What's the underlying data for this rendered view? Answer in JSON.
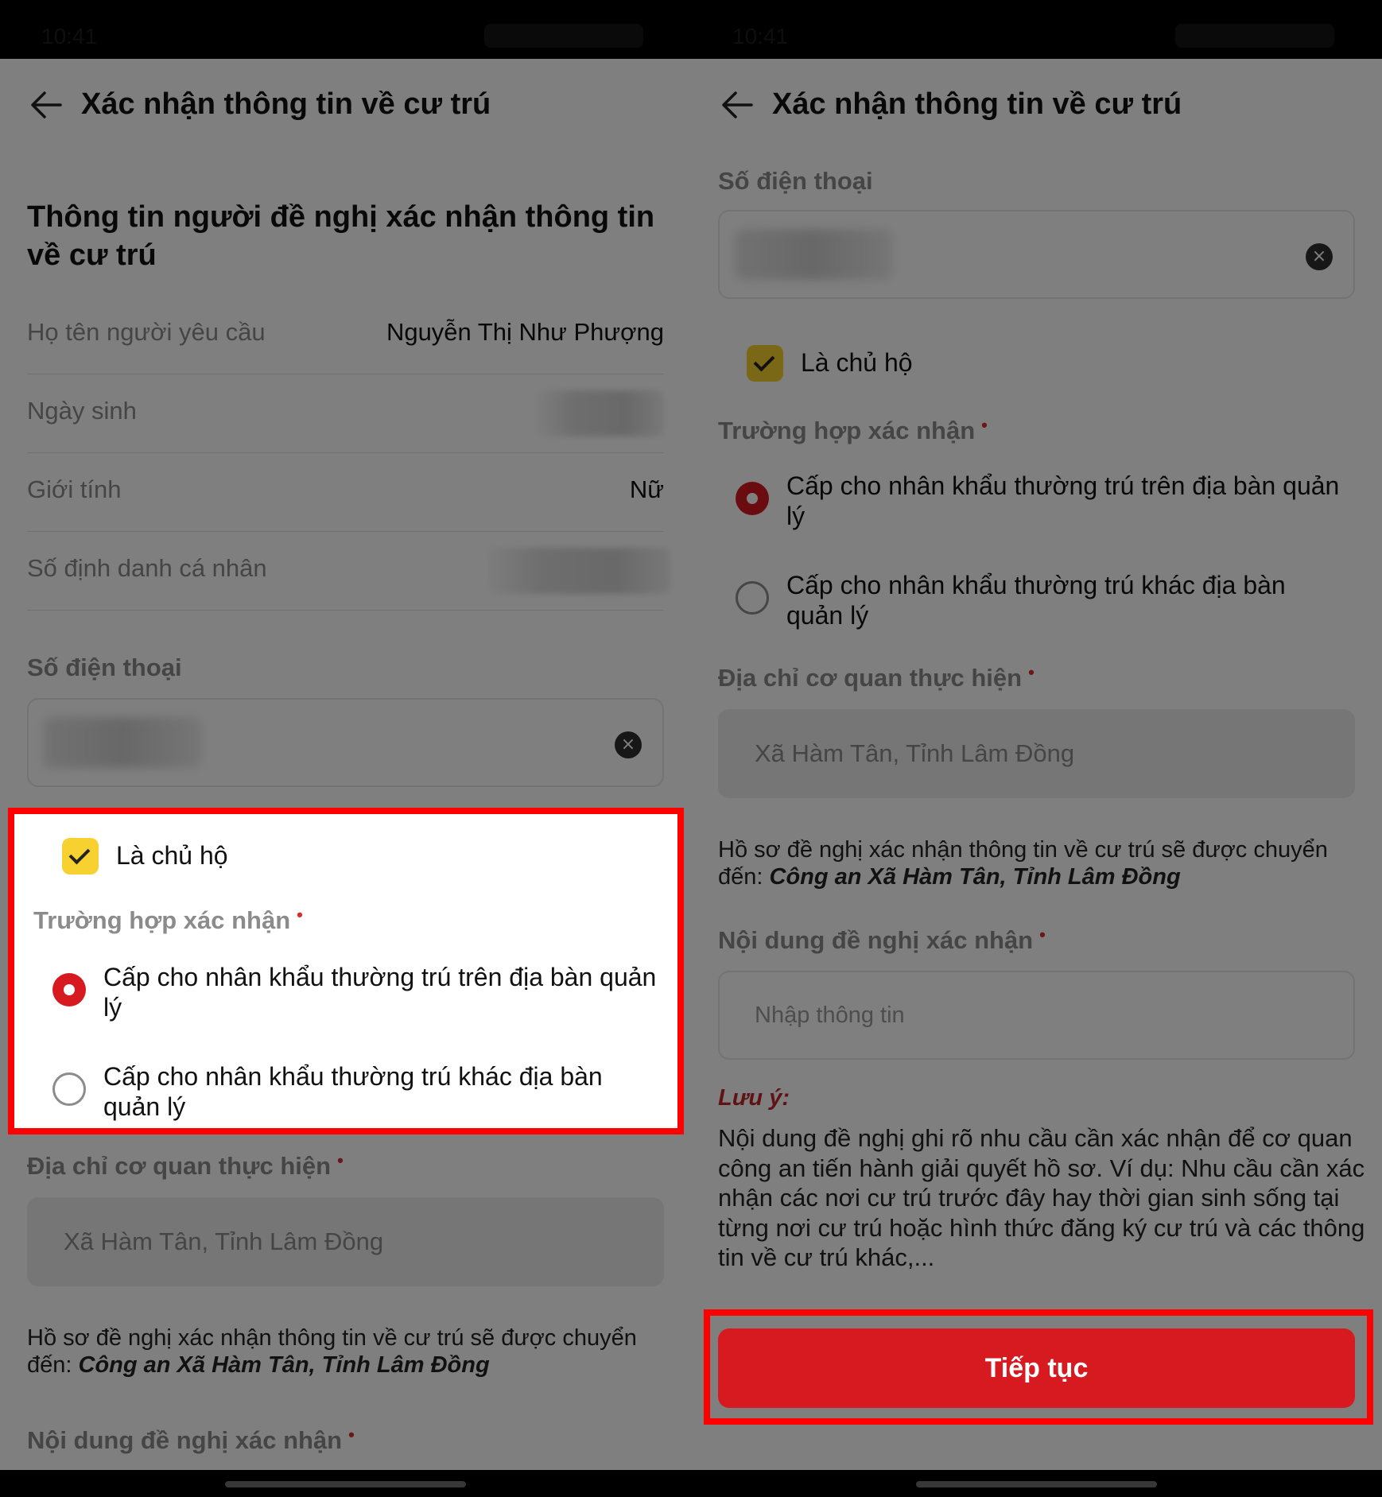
{
  "app": {
    "title": "Xác nhận thông tin về cư trú",
    "status_time": "10:41"
  },
  "section_title": "Thông tin người đề nghị xác nhận thông tin về cư trú",
  "info": {
    "name_label": "Họ tên người yêu cầu",
    "name_value": "Nguyễn Thị Như Phượng",
    "dob_label": "Ngày sinh",
    "gender_label": "Giới tính",
    "gender_value": "Nữ",
    "id_label": "Số định danh cá nhân"
  },
  "phone": {
    "label": "Số điện thoại"
  },
  "head_of_household": {
    "label": "Là chủ hộ",
    "checked": true
  },
  "case": {
    "label": "Trường hợp xác nhận",
    "options": [
      {
        "label": "Cấp cho nhân khẩu thường trú trên địa bàn quản lý",
        "selected": true
      },
      {
        "label": "Cấp cho nhân khẩu thường trú khác địa bàn quản lý",
        "selected": false
      }
    ]
  },
  "agency": {
    "label": "Địa chỉ cơ quan thực hiện",
    "value": "Xã Hàm Tân, Tỉnh Lâm Đồng"
  },
  "transfer": {
    "text": "Hồ sơ đề nghị xác nhận thông tin về cư trú sẽ được chuyển đến:",
    "target": "Công an Xã Hàm Tân, Tỉnh Lâm Đồng"
  },
  "request_content": {
    "label": "Nội dung đề nghị xác nhận",
    "placeholder": "Nhập thông tin"
  },
  "note": {
    "title": "Lưu ý:",
    "text": "Nội dung đề nghị ghi rõ nhu cầu cần xác nhận để cơ quan công an tiến hành giải quyết hồ sơ. Ví dụ: Nhu cầu cần xác nhận các nơi cư trú trước đây hay thời gian sinh sống tại từng nơi cư trú hoặc hình thức đăng ký cư trú và các thông tin về cư trú khác,..."
  },
  "actions": {
    "continue_label": "Tiếp tục"
  },
  "colors": {
    "primary": "#d71920",
    "checkbox": "#f7d12f",
    "annotation": "#ff0000"
  }
}
